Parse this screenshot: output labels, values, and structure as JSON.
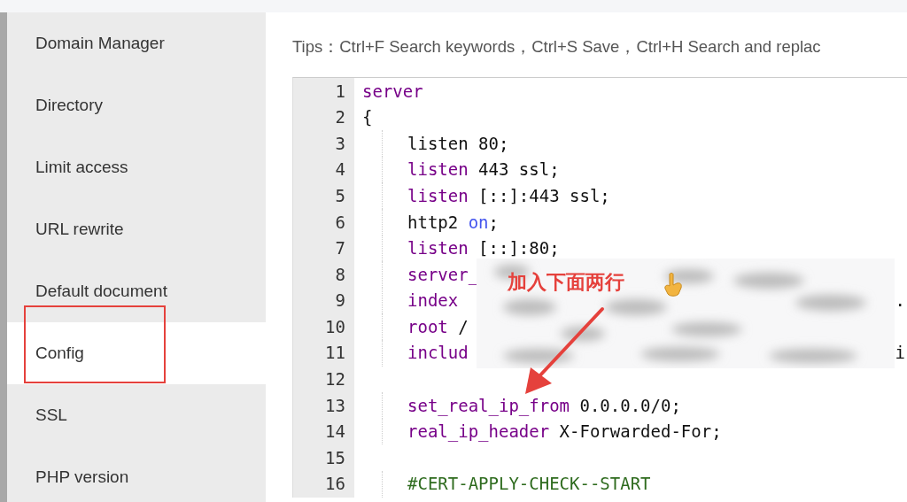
{
  "sidebar": {
    "items": [
      {
        "label": "Domain Manager",
        "selected": false
      },
      {
        "label": "Directory",
        "selected": false
      },
      {
        "label": "Limit access",
        "selected": false
      },
      {
        "label": "URL rewrite",
        "selected": false
      },
      {
        "label": "Default document",
        "selected": false
      },
      {
        "label": "Config",
        "selected": true
      },
      {
        "label": "SSL",
        "selected": false
      },
      {
        "label": "PHP version",
        "selected": false
      }
    ]
  },
  "tips": "Tips：Ctrl+F Search keywords，Ctrl+S Save，Ctrl+H Search and replac",
  "editor": {
    "lines": [
      {
        "number": "1",
        "indented": false,
        "tokens": [
          {
            "kind": "keyword",
            "text": "server"
          }
        ]
      },
      {
        "number": "2",
        "indented": false,
        "tokens": [
          {
            "kind": "plain",
            "text": "{"
          }
        ]
      },
      {
        "number": "3",
        "indented": true,
        "tokens": [
          {
            "kind": "plain",
            "text": "listen 80;"
          }
        ]
      },
      {
        "number": "4",
        "indented": true,
        "tokens": [
          {
            "kind": "keyword",
            "text": "listen"
          },
          {
            "kind": "plain",
            "text": " 443 ssl;"
          }
        ]
      },
      {
        "number": "5",
        "indented": true,
        "tokens": [
          {
            "kind": "keyword",
            "text": "listen"
          },
          {
            "kind": "plain",
            "text": " [::]:443 ssl;"
          }
        ]
      },
      {
        "number": "6",
        "indented": true,
        "tokens": [
          {
            "kind": "plain",
            "text": "http2 "
          },
          {
            "kind": "atom",
            "text": "on"
          },
          {
            "kind": "plain",
            "text": ";"
          }
        ]
      },
      {
        "number": "7",
        "indented": true,
        "tokens": [
          {
            "kind": "keyword",
            "text": "listen"
          },
          {
            "kind": "plain",
            "text": " [::]:80;"
          }
        ]
      },
      {
        "number": "8",
        "indented": true,
        "tokens": [
          {
            "kind": "keyword",
            "text": "server_"
          }
        ]
      },
      {
        "number": "9",
        "indented": true,
        "tokens": [
          {
            "kind": "keyword",
            "text": "index"
          }
        ],
        "tail": "."
      },
      {
        "number": "10",
        "indented": true,
        "tokens": [
          {
            "kind": "keyword",
            "text": "root"
          },
          {
            "kind": "plain",
            "text": " /"
          }
        ]
      },
      {
        "number": "11",
        "indented": true,
        "tokens": [
          {
            "kind": "keyword",
            "text": "includ"
          }
        ],
        "tail": "i"
      },
      {
        "number": "12",
        "indented": false
      },
      {
        "number": "13",
        "indented": true,
        "tokens": [
          {
            "kind": "keyword",
            "text": "set_real_ip_from"
          },
          {
            "kind": "plain",
            "text": " 0.0.0.0/0;"
          }
        ]
      },
      {
        "number": "14",
        "indented": true,
        "tokens": [
          {
            "kind": "keyword",
            "text": "real_ip_header"
          },
          {
            "kind": "plain",
            "text": " X-Forwarded-For;"
          }
        ]
      },
      {
        "number": "15",
        "indented": false
      },
      {
        "number": "16",
        "indented": true,
        "tokens": [
          {
            "kind": "comment",
            "text": "#CERT-APPLY-CHECK--START"
          }
        ]
      }
    ]
  },
  "annotation": {
    "text": "加入下面两行"
  }
}
